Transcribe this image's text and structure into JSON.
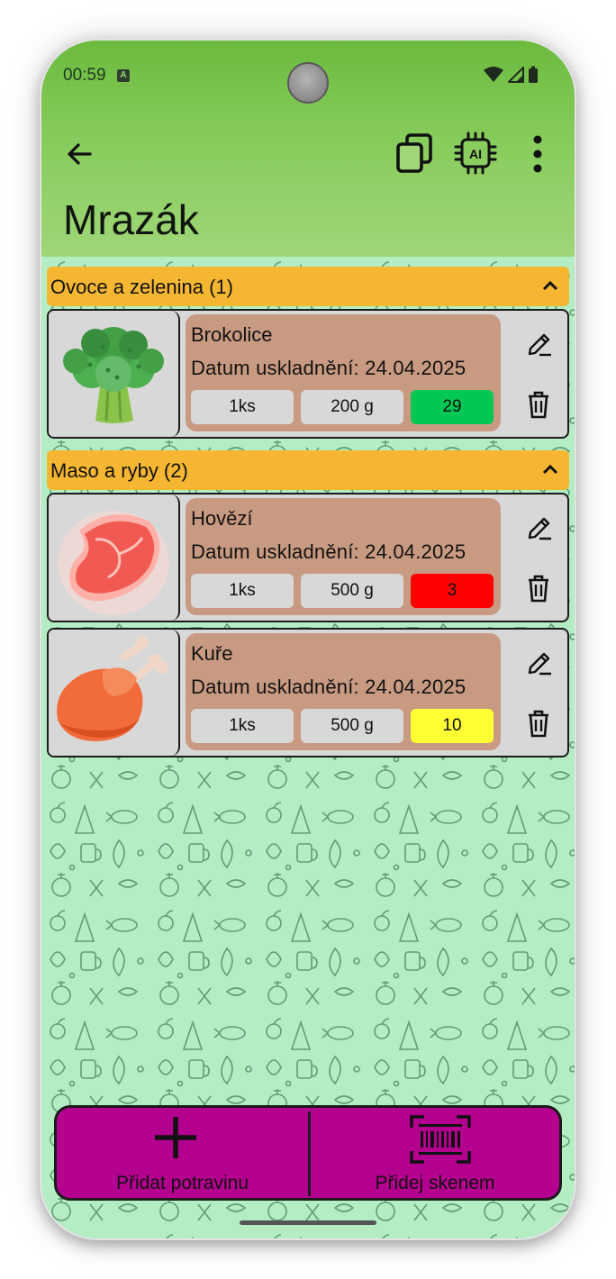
{
  "status_bar": {
    "time": "00:59",
    "notif_icon": "a-badge-icon"
  },
  "app_bar": {
    "title": "Mrazák",
    "back_icon": "arrow-left-icon",
    "actions": [
      "copy-icon",
      "ai-chip-icon",
      "more-vert-icon"
    ]
  },
  "colors": {
    "app_bar": "#86cc5c",
    "background": "#b4ecc4",
    "category_header": "#f5b731",
    "item_card": "#c99a82",
    "chip": "#d8d8d8",
    "bottom_bar": "#b4008e",
    "days_green": "#00c853",
    "days_red": "#ff0000",
    "days_yellow": "#ffff33"
  },
  "categories": [
    {
      "title": "Ovoce a zelenina (1)",
      "items": [
        {
          "name": "Brokolice",
          "date": "Datum uskladnění: 24.04.2025",
          "qty": "1ks",
          "weight": "200 g",
          "days": "29",
          "days_color": "#00c853",
          "image": "broccoli-icon"
        }
      ]
    },
    {
      "title": "Maso a ryby (2)",
      "items": [
        {
          "name": "Hovězí",
          "date": "Datum uskladnění: 24.04.2025",
          "qty": "1ks",
          "weight": "500 g",
          "days": "3",
          "days_color": "#ff0000",
          "image": "beef-steak-icon"
        },
        {
          "name": "Kuře",
          "date": "Datum uskladnění: 24.04.2025",
          "qty": "1ks",
          "weight": "500 g",
          "days": "10",
          "days_color": "#ffff33",
          "image": "chicken-icon"
        }
      ]
    }
  ],
  "bottom_bar": {
    "add_label": "Přidat potravinu",
    "scan_label": "Přidej skenem"
  }
}
